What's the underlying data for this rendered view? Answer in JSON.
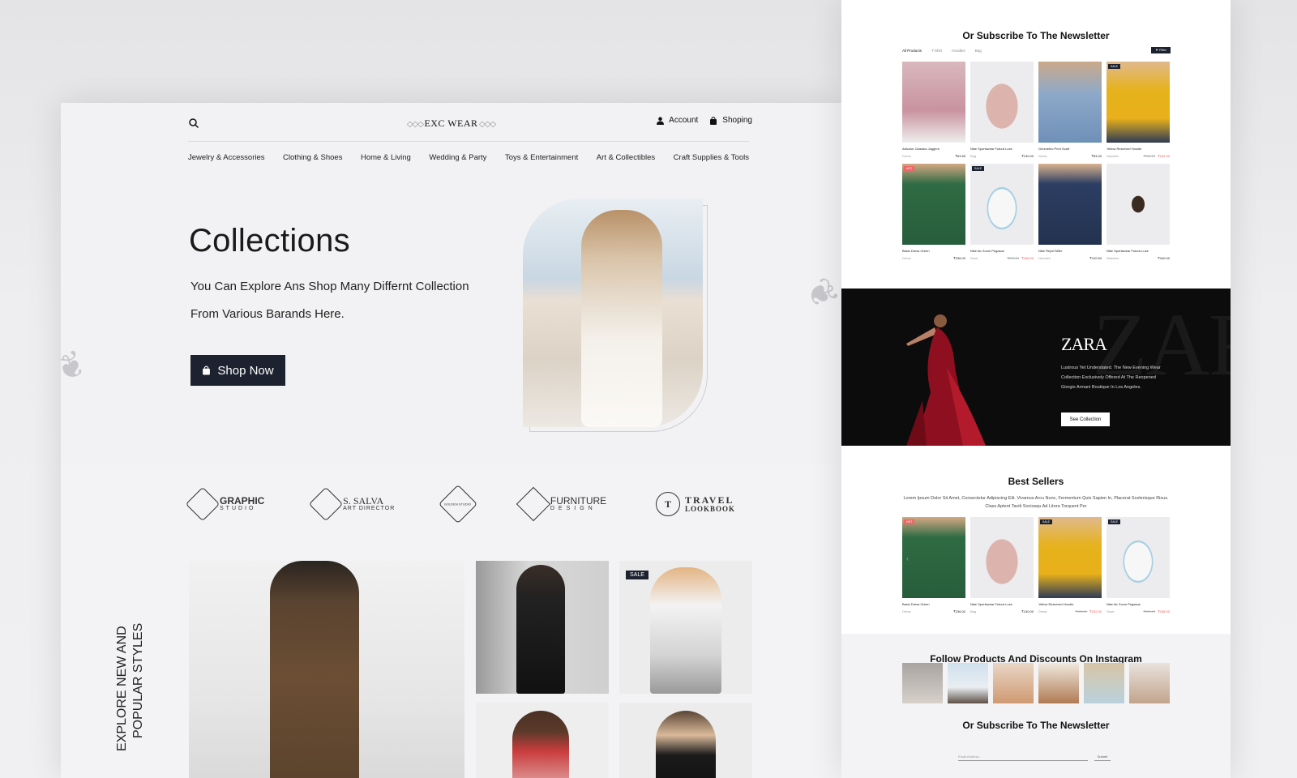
{
  "left": {
    "logo": "EXC WEAR",
    "account": "Account",
    "shopping": "Shoping",
    "nav": [
      "Jewelry & Accessories",
      "Clothing & Shoes",
      "Home & Living",
      "Wedding & Party",
      "Toys & Entertainment",
      "Art & Collectibles",
      "Craft Supplies & Tools"
    ],
    "hero_title": "Collections",
    "hero_sub_line1": "You Can Explore Ans Shop Many Differnt Collection",
    "hero_sub_line2": "From Various Barands Here.",
    "shop_now": "Shop Now",
    "brands": [
      {
        "title": "GRAPHIC",
        "sub": "STUDIO"
      },
      {
        "title": "S. SALVA",
        "sub": "ART DIRECTOR"
      },
      {
        "title": "GOLDEN STUDIO",
        "sub": ""
      },
      {
        "title": "FURNITURE",
        "sub": "DESIGN"
      },
      {
        "title": "TRAVEL",
        "sub": "LOOKBOOK"
      }
    ],
    "explore_line1": "EXPLORE NEW AND",
    "explore_line2": "POPULAR STYLES",
    "sale_tag": "SALE"
  },
  "right": {
    "newsletter_title_top": "Or Subscribe To The Newsletter",
    "filter_tabs": [
      "All Products",
      "T-Shirt",
      "Hoodies",
      "Bag"
    ],
    "filter_btn": "Filter",
    "products": [
      {
        "name": "Adicolor Classics Joggers",
        "cat": "Dress",
        "old": "",
        "price": "₹63.85",
        "tag": ""
      },
      {
        "name": "Nike Sportswear Futura Luxe",
        "cat": "Bag",
        "old": "",
        "price": "₹130.00",
        "tag": ""
      },
      {
        "name": "Geometric Print Scarf",
        "cat": "Dress",
        "old": "",
        "price": "₹53.00",
        "tag": ""
      },
      {
        "name": "Yellow Reserved Hoodie",
        "cat": "Hoodies",
        "old": "₹155.00",
        "price": "₹152.00",
        "tag": "SALE"
      },
      {
        "name": "Basic Dress Green",
        "cat": "Dress",
        "old": "",
        "price": "₹236.00",
        "tag": "HOT"
      },
      {
        "name": "Nike Air Zoom Pegasus",
        "cat": "Shoe",
        "old": "₹220.00",
        "price": "₹198.00",
        "tag": "SALE"
      },
      {
        "name": "Nike Repel Miler",
        "cat": "Hoodies",
        "old": "",
        "price": "₹120.50",
        "tag": ""
      },
      {
        "name": "Nike Sportswear Futura Luxe",
        "cat": "Watches",
        "old": "",
        "price": "₹160.00",
        "tag": ""
      }
    ],
    "zara_logo": "ZARA",
    "zara_text": "Lustrous Yet Understated. The New Evening Wear Collection Exclusively Offered At The Reopened Giorgio Armani Boutique In Los Angeles.",
    "zara_btn": "See Collection",
    "best_title": "Best Sellers",
    "best_desc": "Lorem Ipsum Dolor Sit Amet, Consectetur Adipiscing Elit. Vivamus Arcu Nunc, Fermentum Quis Sapien In, Placerat Scelerisque Risus. Class Aptent Taciti Sociosqu Ad Litora Torquent Per",
    "best": [
      {
        "name": "Basic Dress Green",
        "cat": "Dress",
        "old": "",
        "price": "₹236.00",
        "tag": "HOT"
      },
      {
        "name": "Nike Sportswear Futura Luxe",
        "cat": "Bag",
        "old": "",
        "price": "₹130.00",
        "tag": ""
      },
      {
        "name": "Yellow Reserved Hoodie",
        "cat": "Dress",
        "old": "₹155.00",
        "price": "₹152.00",
        "tag": "SALE"
      },
      {
        "name": "Nike Air Zoom Pegasus",
        "cat": "Shoe",
        "old": "₹220.00",
        "price": "₹198.00",
        "tag": "SALE"
      }
    ],
    "insta_title": "Follow Products And Discounts On Instagram",
    "newsletter_title": "Or Subscribe To The Newsletter",
    "email_placeholder": "Email Address...",
    "submit": "Submit"
  }
}
